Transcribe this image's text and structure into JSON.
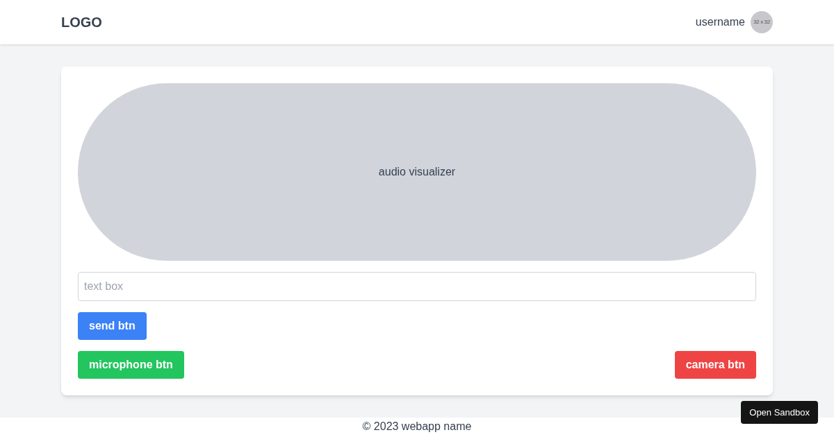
{
  "header": {
    "logo": "LOGO",
    "username": "username",
    "avatar_text": "32 x 32"
  },
  "visualizer": {
    "label": "audio visualizer"
  },
  "text_box": {
    "placeholder": "text box"
  },
  "buttons": {
    "send": "send btn",
    "microphone": "microphone btn",
    "camera": "camera btn"
  },
  "footer": {
    "text": "© 2023 webapp name"
  },
  "sandbox_button": "Open Sandbox"
}
